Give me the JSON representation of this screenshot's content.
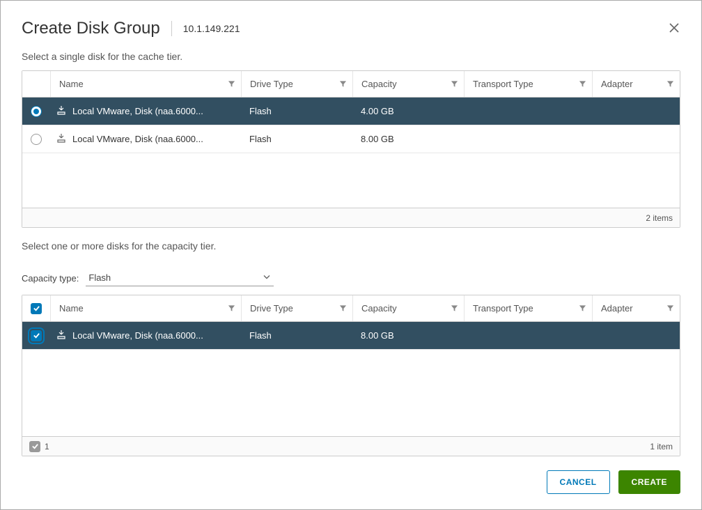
{
  "dialog": {
    "title": "Create Disk Group",
    "host": "10.1.149.221"
  },
  "cache": {
    "instruction": "Select a single disk for the cache tier.",
    "columns": {
      "name": "Name",
      "drive_type": "Drive Type",
      "capacity": "Capacity",
      "transport": "Transport Type",
      "adapter": "Adapter"
    },
    "rows": [
      {
        "name": "Local VMware, Disk (naa.6000...",
        "drive_type": "Flash",
        "capacity": "4.00 GB",
        "selected": true
      },
      {
        "name": "Local VMware, Disk (naa.6000...",
        "drive_type": "Flash",
        "capacity": "8.00 GB",
        "selected": false
      }
    ],
    "footer_count": "2 items"
  },
  "capacity": {
    "instruction": "Select one or more disks for the capacity tier.",
    "type_label": "Capacity type:",
    "type_selected": "Flash",
    "columns": {
      "name": "Name",
      "drive_type": "Drive Type",
      "capacity": "Capacity",
      "transport": "Transport Type",
      "adapter": "Adapter"
    },
    "rows": [
      {
        "name": "Local VMware, Disk (naa.6000...",
        "drive_type": "Flash",
        "capacity": "8.00 GB",
        "checked": true
      }
    ],
    "footer_selected": "1",
    "footer_count": "1 item"
  },
  "buttons": {
    "cancel": "CANCEL",
    "create": "CREATE"
  },
  "colors": {
    "accent": "#0079b8",
    "row_selected_bg": "#324f61",
    "create_bg": "#3c8500"
  }
}
